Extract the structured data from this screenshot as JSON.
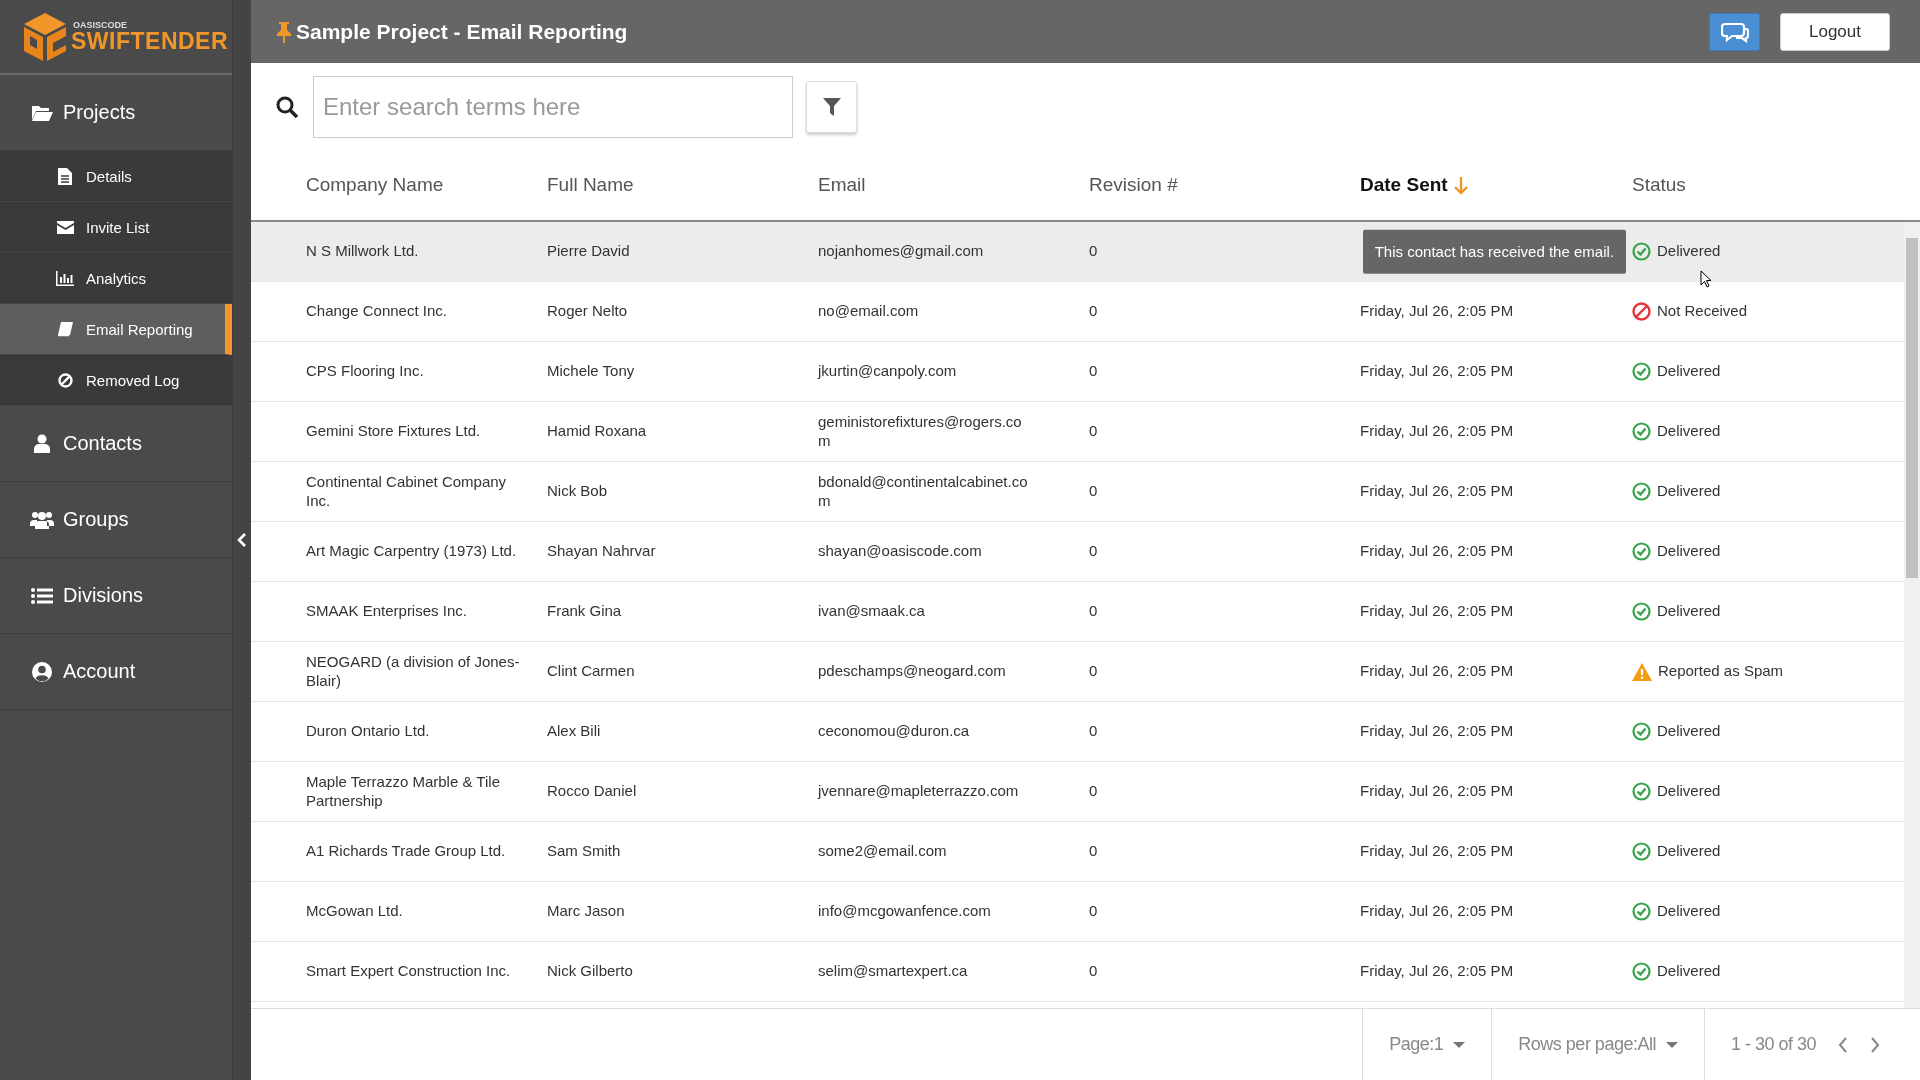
{
  "brand": {
    "small": "OASISCODE",
    "name": "SWIFTENDER"
  },
  "sidebar": {
    "items": [
      {
        "label": "Projects",
        "children": [
          {
            "label": "Details",
            "selected": false
          },
          {
            "label": "Invite List",
            "selected": false
          },
          {
            "label": "Analytics",
            "selected": false
          },
          {
            "label": "Email Reporting",
            "selected": true
          },
          {
            "label": "Removed Log",
            "selected": false
          }
        ]
      },
      {
        "label": "Contacts"
      },
      {
        "label": "Groups"
      },
      {
        "label": "Divisions"
      },
      {
        "label": "Account"
      }
    ]
  },
  "header": {
    "title": "Sample Project - Email Reporting",
    "logout": "Logout"
  },
  "search": {
    "placeholder": "Enter search terms here"
  },
  "table": {
    "columns": [
      {
        "label": "Company Name"
      },
      {
        "label": "Full Name"
      },
      {
        "label": "Email"
      },
      {
        "label": "Revision #"
      },
      {
        "label": "Date Sent",
        "sorted": true
      },
      {
        "label": "Status"
      }
    ],
    "rows": [
      {
        "company": "N S Millwork Ltd.",
        "name": "Pierre David",
        "email": "nojanhomes@gmail.com",
        "revision": "0",
        "status": "Delivered",
        "kind": "delivered",
        "selected": true,
        "tooltip": "This contact has received the email."
      },
      {
        "company": "Change Connect Inc.",
        "name": "Roger Nelto",
        "email": "no@email.com",
        "revision": "0",
        "date": "Friday, Jul 26, 2:05 PM",
        "status": "Not Received",
        "kind": "not_received",
        "selected": false
      },
      {
        "company": "CPS Flooring Inc.",
        "name": "Michele Tony",
        "email": "jkurtin@canpoly.com",
        "revision": "0",
        "date": "Friday, Jul 26, 2:05 PM",
        "status": "Delivered",
        "kind": "delivered",
        "selected": false
      },
      {
        "company": "Gemini Store Fixtures Ltd.",
        "name": "Hamid Roxana",
        "email": "geministorefixtures@rogers.com",
        "revision": "0",
        "date": "Friday, Jul 26, 2:05 PM",
        "status": "Delivered",
        "kind": "delivered",
        "selected": false
      },
      {
        "company": "Continental Cabinet Company Inc.",
        "name": "Nick Bob",
        "email": "bdonald@continentalcabinet.com",
        "revision": "0",
        "date": "Friday, Jul 26, 2:05 PM",
        "status": "Delivered",
        "kind": "delivered",
        "selected": false
      },
      {
        "company": "Art Magic Carpentry (1973) Ltd.",
        "name": "Shayan Nahrvar",
        "email": "shayan@oasiscode.com",
        "revision": "0",
        "date": "Friday, Jul 26, 2:05 PM",
        "status": "Delivered",
        "kind": "delivered",
        "selected": false
      },
      {
        "company": "SMAAK Enterprises Inc.",
        "name": "Frank Gina",
        "email": "ivan@smaak.ca",
        "revision": "0",
        "date": "Friday, Jul 26, 2:05 PM",
        "status": "Delivered",
        "kind": "delivered",
        "selected": false
      },
      {
        "company": "NEOGARD (a division of Jones-Blair)",
        "name": "Clint Carmen",
        "email": "pdeschamps@neogard.com",
        "revision": "0",
        "date": "Friday, Jul 26, 2:05 PM",
        "status": "Reported as Spam",
        "kind": "spam",
        "selected": false
      },
      {
        "company": "Duron Ontario Ltd.",
        "name": "Alex Bili",
        "email": "ceconomou@duron.ca",
        "revision": "0",
        "date": "Friday, Jul 26, 2:05 PM",
        "status": "Delivered",
        "kind": "delivered",
        "selected": false
      },
      {
        "company": "Maple Terrazzo Marble & Tile Partnership",
        "name": "Rocco Daniel",
        "email": "jvennare@mapleterrazzo.com",
        "revision": "0",
        "date": "Friday, Jul 26, 2:05 PM",
        "status": "Delivered",
        "kind": "delivered",
        "selected": false
      },
      {
        "company": "A1 Richards Trade Group Ltd.",
        "name": "Sam Smith",
        "email": "some2@email.com",
        "revision": "0",
        "date": "Friday, Jul 26, 2:05 PM",
        "status": "Delivered",
        "kind": "delivered",
        "selected": false
      },
      {
        "company": "McGowan Ltd.",
        "name": "Marc Jason",
        "email": "info@mcgowanfence.com",
        "revision": "0",
        "date": "Friday, Jul 26, 2:05 PM",
        "status": "Delivered",
        "kind": "delivered",
        "selected": false
      },
      {
        "company": "Smart Expert Construction Inc.",
        "name": "Nick Gilberto",
        "email": "selim@smartexpert.ca",
        "revision": "0",
        "date": "Friday, Jul 26, 2:05 PM",
        "status": "Delivered",
        "kind": "delivered",
        "selected": false
      }
    ]
  },
  "pagination": {
    "page": "Page:1",
    "rows_per_page": "Rows per page:All",
    "range": "1 - 30 of 30"
  }
}
